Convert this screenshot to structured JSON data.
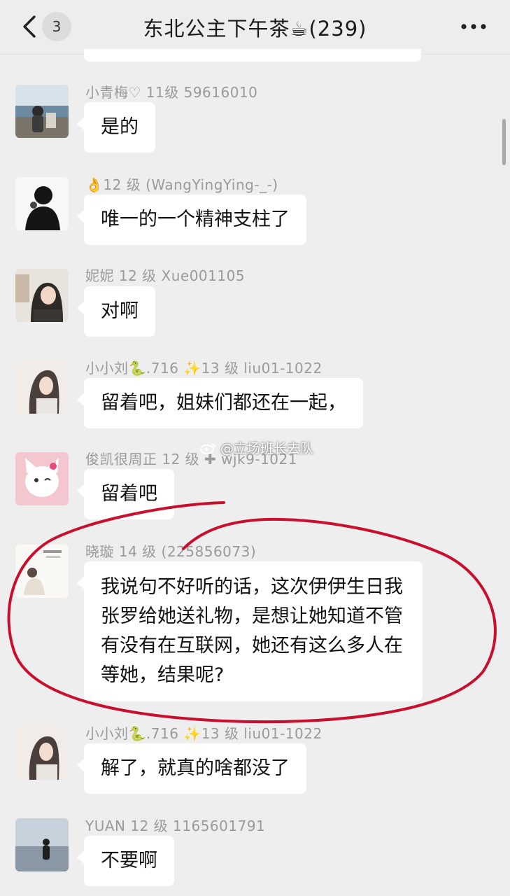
{
  "header": {
    "back_icon": "chevron-left-icon",
    "unread_count": "3",
    "title": "东北公主下午茶☕(239)",
    "more_icon": "more-dots-icon",
    "more_label": "···"
  },
  "messages": [
    {
      "sender": "小青梅♡  11级  59616010",
      "text": "是的"
    },
    {
      "sender": "👌12 级 (WangYingYing-_-)",
      "text": "唯一的一个精神支柱了"
    },
    {
      "sender": "妮妮  12 级 Xue001105",
      "text": "对啊"
    },
    {
      "sender": "小小刘🐍.716 ✨13 级 liu01-1022",
      "text": "留着吧，姐妹们都还在一起，"
    },
    {
      "sender": "俊凯很周正 12 级 ✚ wjk9-1021",
      "text": "留着吧"
    },
    {
      "sender": "晓璇 14 级 (225856073)",
      "text": "我说句不好听的话，这次伊伊生日我张罗给她送礼物，是想让她知道不管有没有在互联网，她还有这么多人在等她，结果呢?"
    },
    {
      "sender": "小小刘🐍.716 ✨13 级 liu01-1022",
      "text": "解了，就真的啥都没了"
    },
    {
      "sender": "YUAN 12 级 1165601791",
      "text": "不要啊"
    }
  ],
  "watermark": "@立场班长去队",
  "colors": {
    "background": "#eeeeee",
    "bubble": "#ffffff",
    "annotation": "#c8102e"
  }
}
